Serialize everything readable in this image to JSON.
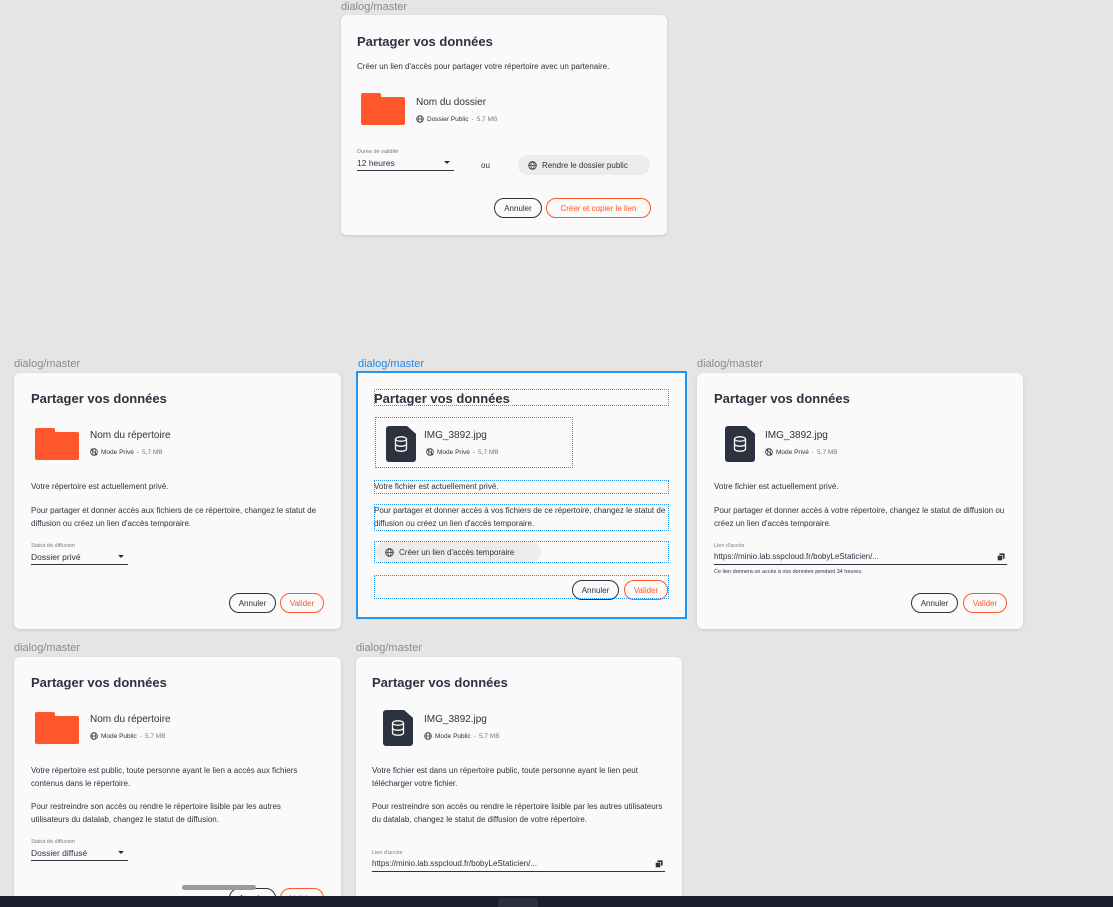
{
  "frame_label": "dialog/master",
  "dialog_top": {
    "title": "Partager vos données",
    "description": "Créer un lien d'accès pour partager votre répertoire avec un partenaire.",
    "item_name": "Nom du dossier",
    "item_status": "Dossier Public",
    "item_sep": "-",
    "item_size": "5,7 MB",
    "validity_label": "Durée de validité",
    "validity_value": "12 heures",
    "or_text": "ou",
    "public_button": "Rendre le dossier public",
    "cancel": "Annuler",
    "confirm": "Créer et copier le lien"
  },
  "dialog_private_folder": {
    "title": "Partager vos données",
    "item_name": "Nom du répertoire",
    "item_status": "Mode Privé",
    "item_sep": "-",
    "item_size": "5,7 MB",
    "status_text": "Votre répertoire est actuellement privé.",
    "help_text": "Pour partager et donner accès aux fichiers de ce répertoire, changez le statut de diffusion ou créez un lien d'accès temporaire.",
    "field_label": "Statut de diffusion",
    "field_value": "Dossier privé",
    "cancel": "Annuler",
    "confirm": "Valider"
  },
  "dialog_private_file": {
    "title": "Partager vos données",
    "item_name": "IMG_3892.jpg",
    "item_status": "Mode Privé",
    "item_sep": "-",
    "item_size": "5,7 MB",
    "status_text": "Votre fichier est actuellement privé.",
    "help_text": "Pour partager et donner accès à vos fichiers de ce répertoire, changez le statut de diffusion ou créez un lien d'accès temporaire.",
    "temp_link_button": "Créer un lien d'accès temporaire",
    "cancel": "Annuler",
    "confirm": "Valider"
  },
  "dialog_private_file_link": {
    "title": "Partager vos données",
    "item_name": "IMG_3892.jpg",
    "item_status": "Mode Privé",
    "item_sep": "-",
    "item_size": "5,7 MB",
    "status_text": "Votre fichier est actuellement privé.",
    "help_text": "Pour partager et donner accès à votre répertoire, changez le statut de diffusion ou créez un lien d'accès temporaire.",
    "link_label": "Lien d'accès",
    "link_value": "https://minio.lab.sspcloud.fr/bobyLeStaticien/...",
    "link_note": "Ce lien donnera un accès à vos données pendant 34 heures.",
    "cancel": "Annuler",
    "confirm": "Valider"
  },
  "dialog_public_folder": {
    "title": "Partager vos données",
    "item_name": "Nom du répertoire",
    "item_status": "Mode Public",
    "item_sep": "-",
    "item_size": "5,7 MB",
    "status_text": "Votre répertoire est public, toute personne ayant le lien a accès aux fichiers contenus dans le répertoire.",
    "help_text": "Pour restreindre son accès ou rendre le répertoire lisible par les autres utilisateurs du datalab, changez le statut de diffusion.",
    "field_label": "Statut de diffusion",
    "field_value": "Dossier diffusé",
    "cancel": "Annuler",
    "confirm": "Valider"
  },
  "dialog_public_file": {
    "title": "Partager vos données",
    "item_name": "IMG_3892.jpg",
    "item_status": "Mode Public",
    "item_sep": "-",
    "item_size": "5,7 MB",
    "status_text": "Votre fichier est dans un répertoire public, toute personne ayant le lien peut télécharger votre fichier.",
    "help_text": "Pour restreindre son accès ou rendre le répertoire lisible par les autres utilisateurs du datalab, changez le statut de diffusion de votre répertoire.",
    "link_label": "Lien d'accès",
    "link_value": "https://minio.lab.sspcloud.fr/bobyLeStaticien/..."
  },
  "colors": {
    "accent": "#ff562c",
    "ink": "#2c323f",
    "selection": "#2196f3",
    "background": "#e5e5e5"
  }
}
